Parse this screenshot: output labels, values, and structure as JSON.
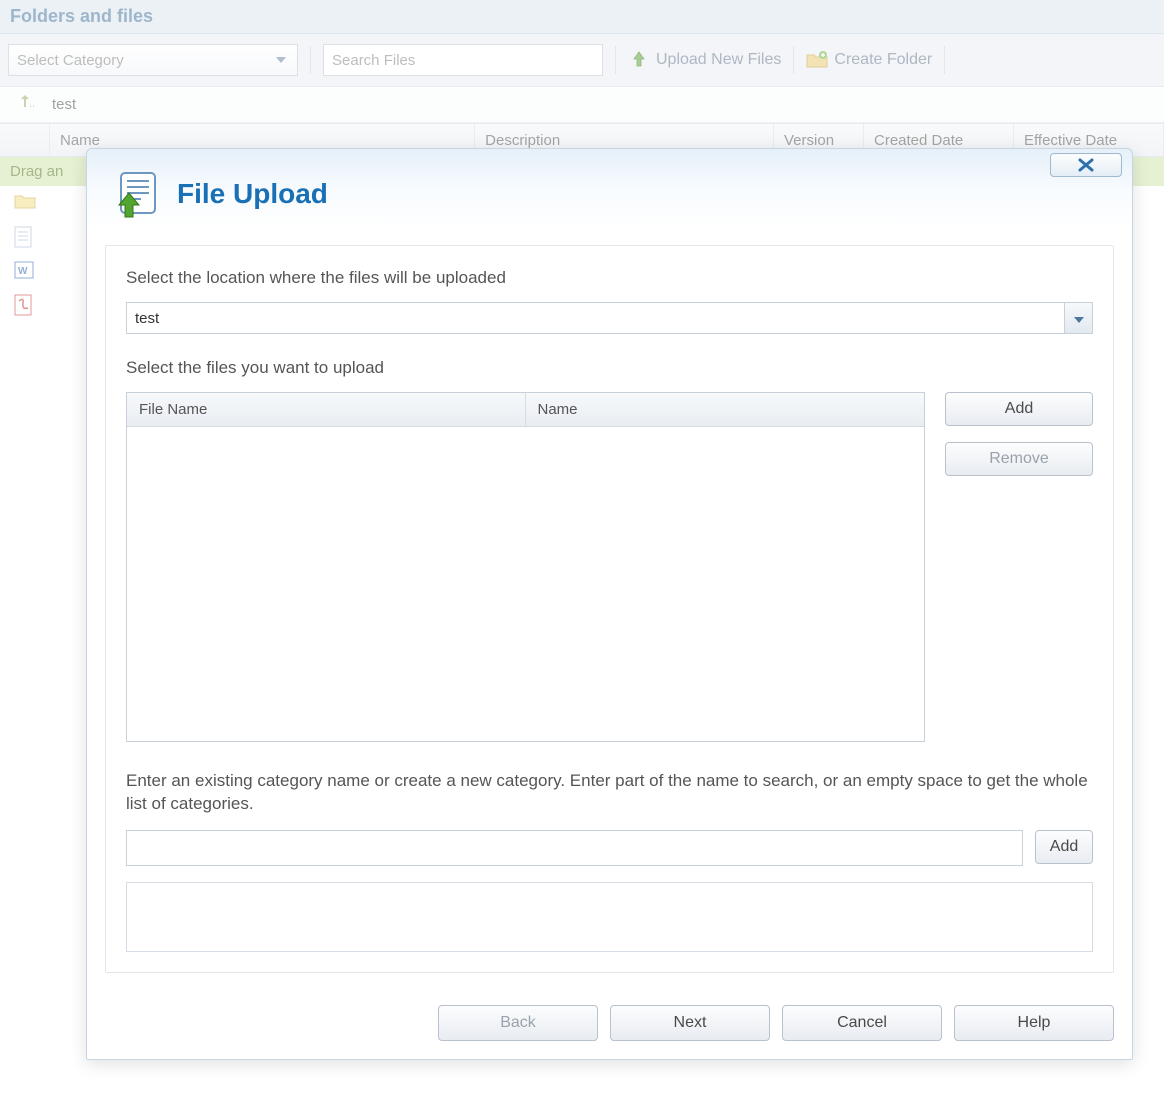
{
  "page": {
    "title": "Folders and files",
    "category_placeholder": "Select Category",
    "search_placeholder": "Search Files",
    "upload_btn": "Upload New Files",
    "create_folder_btn": "Create Folder",
    "breadcrumb": "test",
    "columns": {
      "name": "Name",
      "description": "Description",
      "version": "Version",
      "created_date": "Created Date",
      "effective_date": "Effective Date"
    },
    "drop_hint_partial": "Drag an"
  },
  "modal": {
    "title": "File Upload",
    "location_label": "Select the location where the files will be uploaded",
    "location_value": "test",
    "files_label": "Select the files you want to upload",
    "file_table": {
      "col_filename": "File Name",
      "col_name": "Name"
    },
    "add_btn": "Add",
    "remove_btn": "Remove",
    "category_label": "Enter an existing category name or create a new category. Enter part of the name to search, or an empty space to get the whole list of categories.",
    "category_add_btn": "Add",
    "footer": {
      "back": "Back",
      "next": "Next",
      "cancel": "Cancel",
      "help": "Help"
    }
  }
}
